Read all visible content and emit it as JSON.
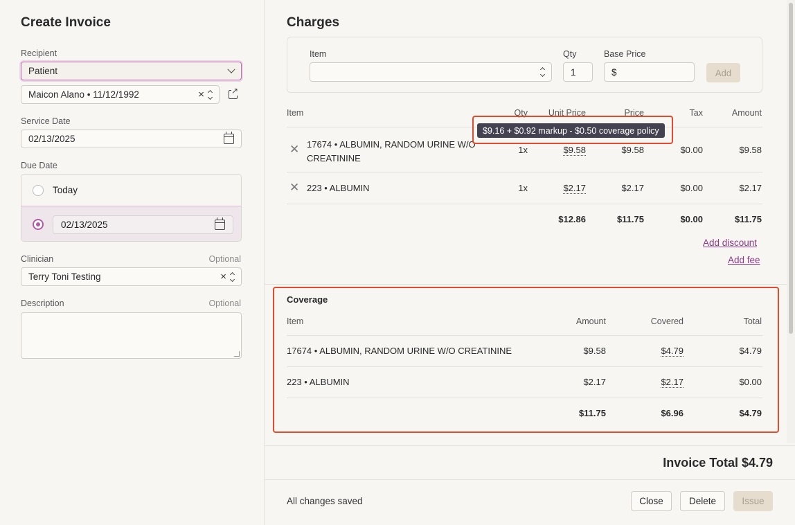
{
  "left": {
    "title": "Create Invoice",
    "recipient_label": "Recipient",
    "recipient_value": "Patient",
    "patient_value": "Maicon Alano • 11/12/1992",
    "service_date_label": "Service Date",
    "service_date_value": "02/13/2025",
    "due_date_label": "Due Date",
    "due_today_label": "Today",
    "due_date_value": "02/13/2025",
    "clinician_label": "Clinician",
    "clinician_optional": "Optional",
    "clinician_value": "Terry Toni Testing",
    "description_label": "Description",
    "description_optional": "Optional"
  },
  "charges": {
    "title": "Charges",
    "add_form": {
      "item_label": "Item",
      "qty_label": "Qty",
      "qty_value": "1",
      "base_price_label": "Base Price",
      "base_price_prefix": "$",
      "add_label": "Add"
    },
    "columns": [
      "Item",
      "Qty",
      "Unit Price",
      "Price",
      "Tax",
      "Amount"
    ],
    "rows": [
      {
        "item_line1": "17674 • ALBUMIN, RANDOM URINE W/O",
        "item_line2": "CREATININE",
        "qty": "1x",
        "unit_price": "$9.58",
        "price": "$9.58",
        "tax": "$0.00",
        "amount": "$9.58"
      },
      {
        "item_line1": "223 • ALBUMIN",
        "item_line2": "",
        "qty": "1x",
        "unit_price": "$2.17",
        "price": "$2.17",
        "tax": "$0.00",
        "amount": "$2.17"
      }
    ],
    "totals": {
      "unit_price": "$12.86",
      "price": "$11.75",
      "tax": "$0.00",
      "amount": "$11.75"
    },
    "tooltip": "$9.16 + $0.92 markup - $0.50 coverage policy",
    "add_discount": "Add discount",
    "add_fee": "Add fee"
  },
  "coverage": {
    "title": "Coverage",
    "columns": [
      "Item",
      "Amount",
      "Covered",
      "Total"
    ],
    "rows": [
      {
        "item": "17674 • ALBUMIN, RANDOM URINE W/O CREATININE",
        "amount": "$9.58",
        "covered": "$4.79",
        "total": "$4.79"
      },
      {
        "item": "223 • ALBUMIN",
        "amount": "$2.17",
        "covered": "$2.17",
        "total": "$0.00"
      }
    ],
    "totals": {
      "amount": "$11.75",
      "covered": "$6.96",
      "total": "$4.79"
    }
  },
  "footer": {
    "invoice_total": "Invoice Total $4.79",
    "status": "All changes saved",
    "close": "Close",
    "delete": "Delete",
    "issue": "Issue"
  },
  "colors": {
    "accent": "#b15aa7",
    "highlight": "#e44a2d",
    "link": "#8f3b86"
  }
}
